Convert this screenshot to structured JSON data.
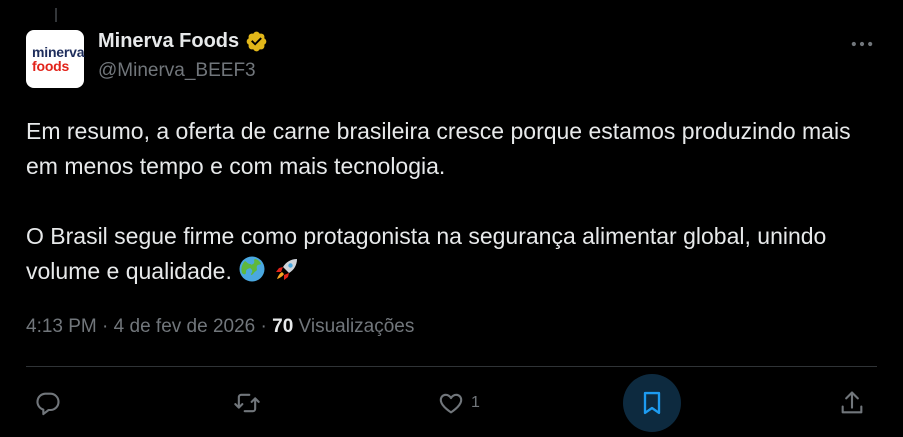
{
  "author": {
    "logo_line1": "minerva",
    "logo_line2": "foods",
    "display_name": "Minerva Foods",
    "handle": "@Minerva_BEEF3",
    "verified_badge_color": "#e2b719"
  },
  "tweet": {
    "paragraph1": "Em resumo, a oferta de carne brasileira cresce porque estamos produzindo mais em menos tempo e com mais tecnologia.",
    "paragraph2": "O Brasil segue firme como protagonista na segurança alimentar global, unindo volume e qualidade.",
    "emojis": [
      "globe-icon",
      "rocket-icon"
    ]
  },
  "meta": {
    "time": "4:13 PM",
    "separator": "·",
    "date": "4 de fev de 2026",
    "views_count": "70",
    "views_label": "Visualizações"
  },
  "actions": {
    "like_count": "1",
    "bookmark_active_color": "#1d9bf0"
  },
  "icons": [
    "more-icon",
    "reply-icon",
    "retweet-icon",
    "like-icon",
    "bookmark-icon",
    "share-icon"
  ]
}
